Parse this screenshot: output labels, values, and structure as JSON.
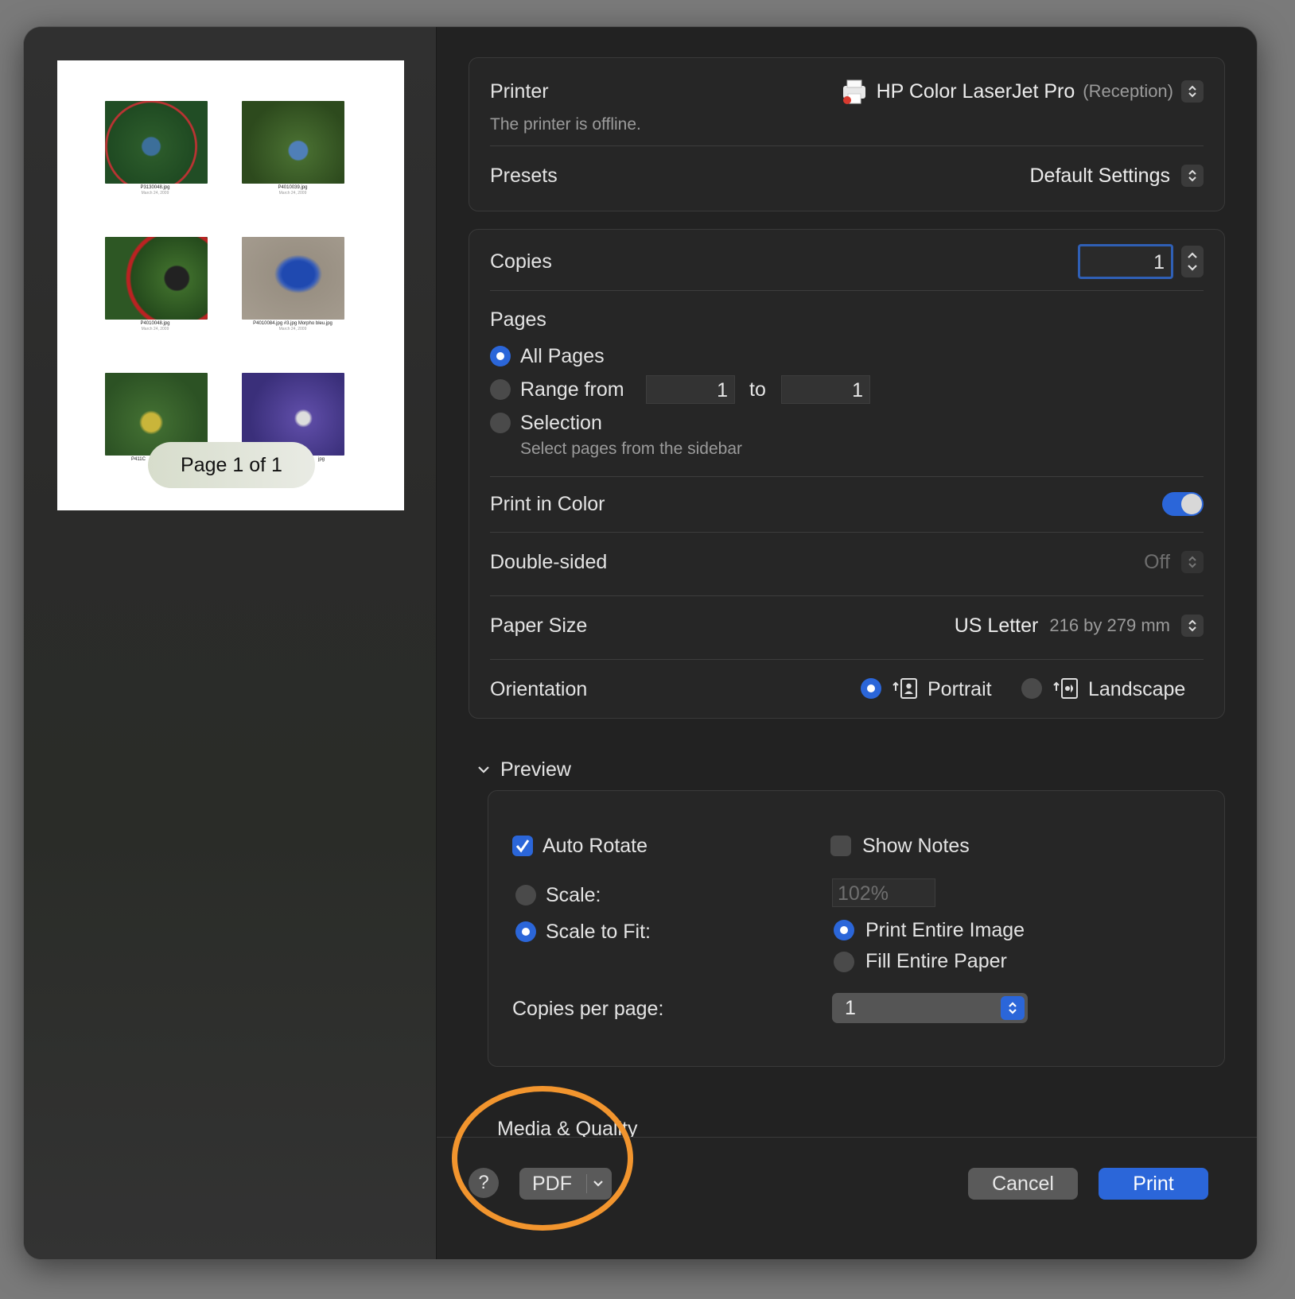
{
  "preview": {
    "photos": [
      {
        "file": "P3130048.jpg",
        "date": "March 24, 2009"
      },
      {
        "file": "P4010039.jpg",
        "date": "March 24, 2009"
      },
      {
        "file": "P4010048.jpg",
        "date": "March 24, 2009"
      },
      {
        "file": "P4010084.jpg #3.jpg Morpho bleu.jpg",
        "date": "March 24, 2009"
      },
      {
        "file": "P411C",
        "date": ""
      },
      {
        "file": "jpg",
        "date": ""
      }
    ],
    "page_indicator": "Page 1 of 1"
  },
  "printer": {
    "label": "Printer",
    "name": "HP Color LaserJet Pro",
    "location": "(Reception)",
    "status": "The printer is offline."
  },
  "presets": {
    "label": "Presets",
    "value": "Default Settings"
  },
  "copies": {
    "label": "Copies",
    "value": "1"
  },
  "pages": {
    "label": "Pages",
    "all": "All Pages",
    "range": "Range from",
    "range_from": "1",
    "to": "to",
    "range_to": "1",
    "selection": "Selection",
    "selection_hint": "Select pages from the sidebar"
  },
  "color": {
    "label": "Print in Color"
  },
  "duplex": {
    "label": "Double-sided",
    "value": "Off"
  },
  "paper": {
    "label": "Paper Size",
    "value": "US Letter",
    "dims": "216 by 279 mm"
  },
  "orientation": {
    "label": "Orientation",
    "portrait": "Portrait",
    "landscape": "Landscape"
  },
  "preview_section": {
    "title": "Preview",
    "auto_rotate": "Auto Rotate",
    "show_notes": "Show Notes",
    "scale": "Scale:",
    "scale_value": "102%",
    "scale_to_fit": "Scale to Fit:",
    "print_entire": "Print Entire Image",
    "fill_entire": "Fill Entire Paper",
    "copies_per_page": "Copies per page:",
    "copies_per_page_value": "1"
  },
  "media_section": {
    "title": "Media & Quality"
  },
  "footer": {
    "help": "?",
    "pdf": "PDF",
    "cancel": "Cancel",
    "print": "Print"
  },
  "colors": {
    "accent": "#2b66d9",
    "highlight_ring": "#f2952e"
  }
}
